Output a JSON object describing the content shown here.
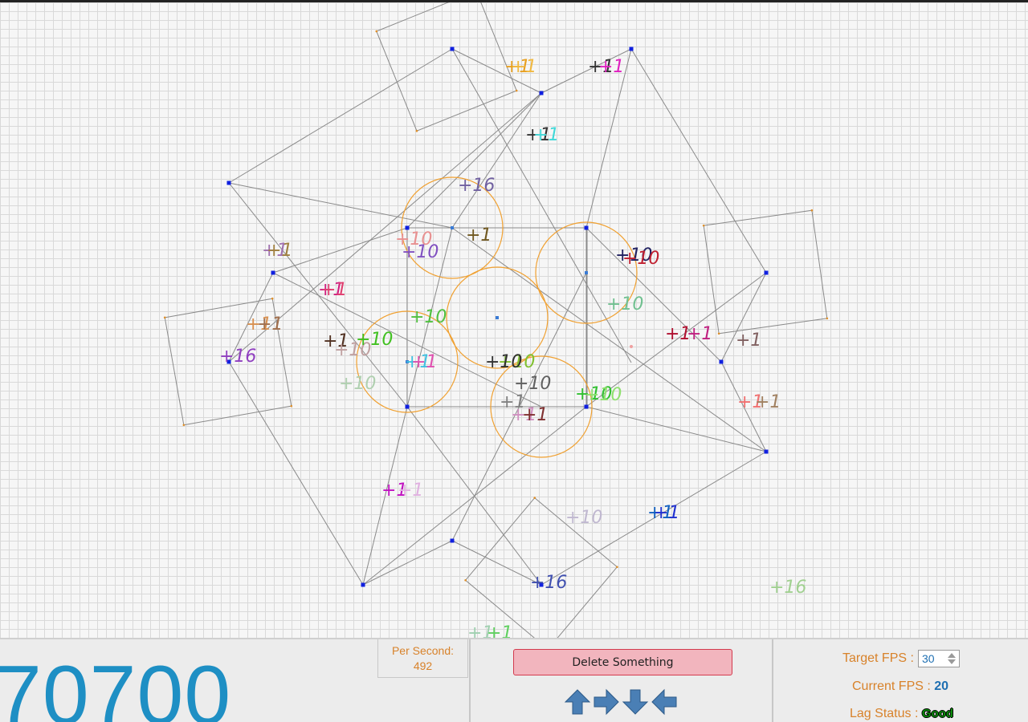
{
  "colors": {
    "accent_blue": "#1e8fc4",
    "label_orange": "#d8822a",
    "circle_orange": "#f0a030",
    "node_blue": "#1020e0",
    "line_gray": "#8a8a8a",
    "delete_bg": "#f2b5be",
    "delete_border": "#d33b4e",
    "lag_good": "#0a8a0a",
    "arrow_blue": "#4a7fb5"
  },
  "score": {
    "value": "70700"
  },
  "per_second": {
    "label": "Per Second:",
    "value": "492"
  },
  "controls": {
    "delete_label": "Delete Something",
    "arrows": [
      "arrow-up-icon",
      "arrow-right-icon",
      "arrow-down-icon",
      "arrow-left-icon"
    ]
  },
  "stats": {
    "target_fps_label": "Target FPS :",
    "target_fps_value": "30",
    "current_fps_label": "Current FPS :",
    "current_fps_value": "20",
    "lag_label": "Lag Status :",
    "lag_value": "Good"
  },
  "floating_texts": [
    {
      "text": "+1",
      "color": "#e8a020"
    },
    {
      "text": "+1",
      "color": "#f0b840"
    },
    {
      "text": "+1",
      "color": "#333333"
    },
    {
      "text": "+1",
      "color": "#e020c0"
    },
    {
      "text": "+1",
      "color": "#333333"
    },
    {
      "text": "+1",
      "color": "#40d8d8"
    },
    {
      "text": "+16",
      "color": "#7060a0"
    },
    {
      "text": "+1",
      "color": "#705820"
    },
    {
      "text": "+10",
      "color": "#e89090"
    },
    {
      "text": "+10",
      "color": "#8050c0"
    },
    {
      "text": "+10",
      "color": "#202060"
    },
    {
      "text": "+10",
      "color": "#c02030"
    },
    {
      "text": "+10",
      "color": "#70c090"
    },
    {
      "text": "+1",
      "color": "#a070b0"
    },
    {
      "text": "+1",
      "color": "#a08040"
    },
    {
      "text": "+1",
      "color": "#d02080"
    },
    {
      "text": "+1",
      "color": "#e04070"
    },
    {
      "text": "+11",
      "color": "#d89050"
    },
    {
      "text": "+1",
      "color": "#a07050"
    },
    {
      "text": "+10",
      "color": "#50c040"
    },
    {
      "text": "+1",
      "color": "#503020"
    },
    {
      "text": "+10",
      "color": "#c0a0a0"
    },
    {
      "text": "+10",
      "color": "#40c020"
    },
    {
      "text": "+16",
      "color": "#9040c0"
    },
    {
      "text": "+10",
      "color": "#b0d0b0"
    },
    {
      "text": "+1",
      "color": "#40c0e0"
    },
    {
      "text": "+1",
      "color": "#e050b0"
    },
    {
      "text": "+10",
      "color": "#80c030"
    },
    {
      "text": "+10",
      "color": "#303030"
    },
    {
      "text": "+10",
      "color": "#606060"
    },
    {
      "text": "+1",
      "color": "#808080"
    },
    {
      "text": "+1",
      "color": "#d090c0"
    },
    {
      "text": "+1",
      "color": "#803030"
    },
    {
      "text": "+10",
      "color": "#30c030"
    },
    {
      "text": "+10",
      "color": "#90e070"
    },
    {
      "text": "+1",
      "color": "#b01030"
    },
    {
      "text": "+1",
      "color": "#c02080"
    },
    {
      "text": "+1",
      "color": "#806060"
    },
    {
      "text": "+1",
      "color": "#f07070"
    },
    {
      "text": "+1",
      "color": "#a08060"
    },
    {
      "text": "+1",
      "color": "#c010c0"
    },
    {
      "text": "+1",
      "color": "#e0b0e0"
    },
    {
      "text": "+10",
      "color": "#c0b8d0"
    },
    {
      "text": "+1",
      "color": "#1060c0"
    },
    {
      "text": "+1",
      "color": "#2030d0"
    },
    {
      "text": "+16",
      "color": "#4050b0"
    },
    {
      "text": "+16",
      "color": "#a0d090"
    },
    {
      "text": "+1",
      "color": "#a0d0b0"
    },
    {
      "text": "+1",
      "color": "#60d060"
    }
  ]
}
